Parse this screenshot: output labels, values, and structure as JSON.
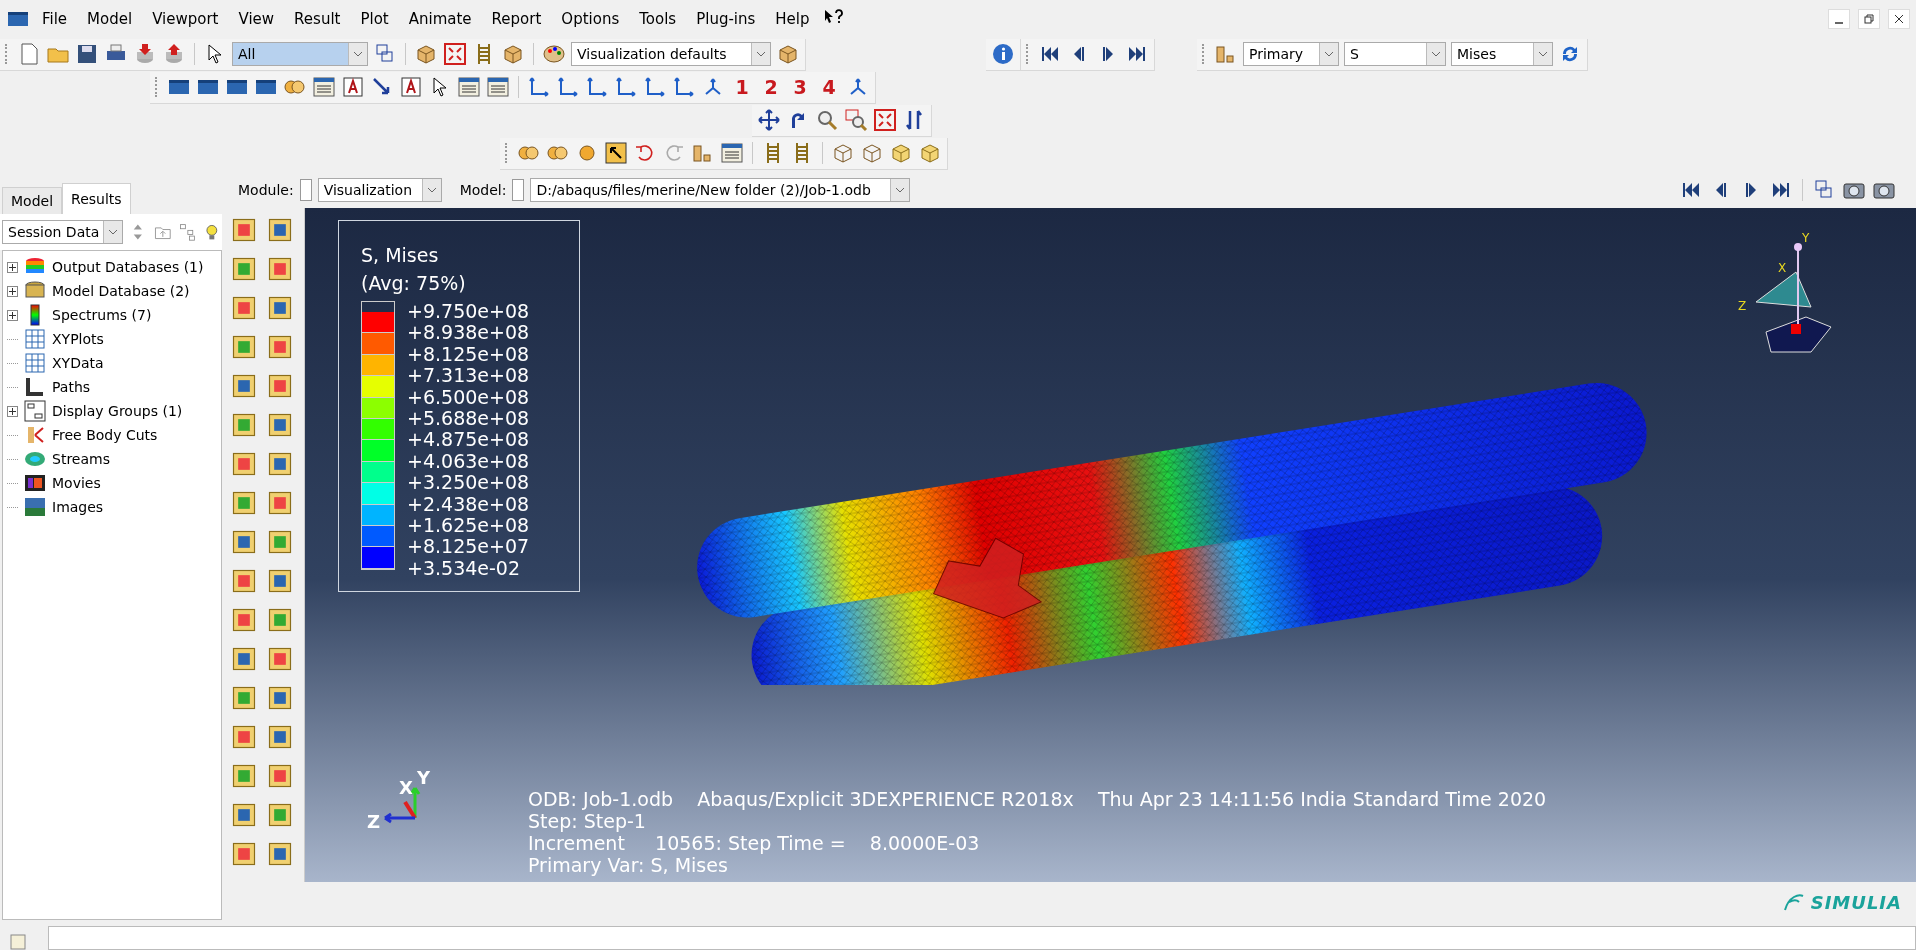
{
  "menu": [
    "File",
    "Model",
    "Viewport",
    "View",
    "Result",
    "Plot",
    "Animate",
    "Report",
    "Options",
    "Tools",
    "Plug-ins",
    "Help"
  ],
  "toolbar": {
    "selection_filter": "All",
    "render_style": "Visualization defaults",
    "view_labels": [
      "1",
      "2",
      "3",
      "4"
    ],
    "field_output": {
      "category": "Primary",
      "variable": "S",
      "invariant": "Mises"
    }
  },
  "tabs": [
    {
      "label": "Model",
      "selected": false
    },
    {
      "label": "Results",
      "selected": true
    }
  ],
  "session_selector": "Session Data",
  "tree": [
    {
      "label": "Output Databases (1)",
      "kind": "odb",
      "expandable": true
    },
    {
      "label": "Model Database (2)",
      "kind": "mdb",
      "expandable": true
    },
    {
      "label": "Spectrums (7)",
      "kind": "spectrum",
      "expandable": true
    },
    {
      "label": "XYPlots",
      "kind": "xyplot",
      "expandable": false
    },
    {
      "label": "XYData",
      "kind": "xydata",
      "expandable": false
    },
    {
      "label": "Paths",
      "kind": "path",
      "expandable": false
    },
    {
      "label": "Display Groups (1)",
      "kind": "group",
      "expandable": true
    },
    {
      "label": "Free Body Cuts",
      "kind": "freebody",
      "expandable": false
    },
    {
      "label": "Streams",
      "kind": "stream",
      "expandable": false
    },
    {
      "label": "Movies",
      "kind": "movie",
      "expandable": false
    },
    {
      "label": "Images",
      "kind": "image",
      "expandable": false
    }
  ],
  "context": {
    "module_label": "Module:",
    "module": "Visualization",
    "model_label": "Model:",
    "model": "D:/abaqus/files/merine/New folder (2)/Job-1.odb"
  },
  "legend": {
    "title": "S, Mises",
    "subtitle": "(Avg: 75%)",
    "bands": [
      {
        "color": "#ff0000"
      },
      {
        "color": "#ff5a00"
      },
      {
        "color": "#ffb400"
      },
      {
        "color": "#e6ff00"
      },
      {
        "color": "#8cff00"
      },
      {
        "color": "#32ff00"
      },
      {
        "color": "#00ff28"
      },
      {
        "color": "#00ff8c"
      },
      {
        "color": "#00ffe6"
      },
      {
        "color": "#00b4ff"
      },
      {
        "color": "#005aff"
      },
      {
        "color": "#0000ff"
      }
    ],
    "ticks": [
      "+9.750e+08",
      "+8.938e+08",
      "+8.125e+08",
      "+7.313e+08",
      "+6.500e+08",
      "+5.688e+08",
      "+4.875e+08",
      "+4.063e+08",
      "+3.250e+08",
      "+2.438e+08",
      "+1.625e+08",
      "+8.125e+07",
      "+3.534e-02"
    ]
  },
  "view_triad": {
    "x": "X",
    "y": "Y",
    "z": "Z"
  },
  "triad": {
    "x": "X",
    "y": "Y",
    "z": "Z"
  },
  "info": [
    "ODB: Job-1.odb    Abaqus/Explicit 3DEXPERIENCE R2018x    Thu Apr 23 14:11:56 India Standard Time 2020",
    "Step: Step-1",
    "Increment     10565: Step Time =    8.0000E-03",
    "Primary Var: S, Mises"
  ],
  "brand": "SIMULIA"
}
